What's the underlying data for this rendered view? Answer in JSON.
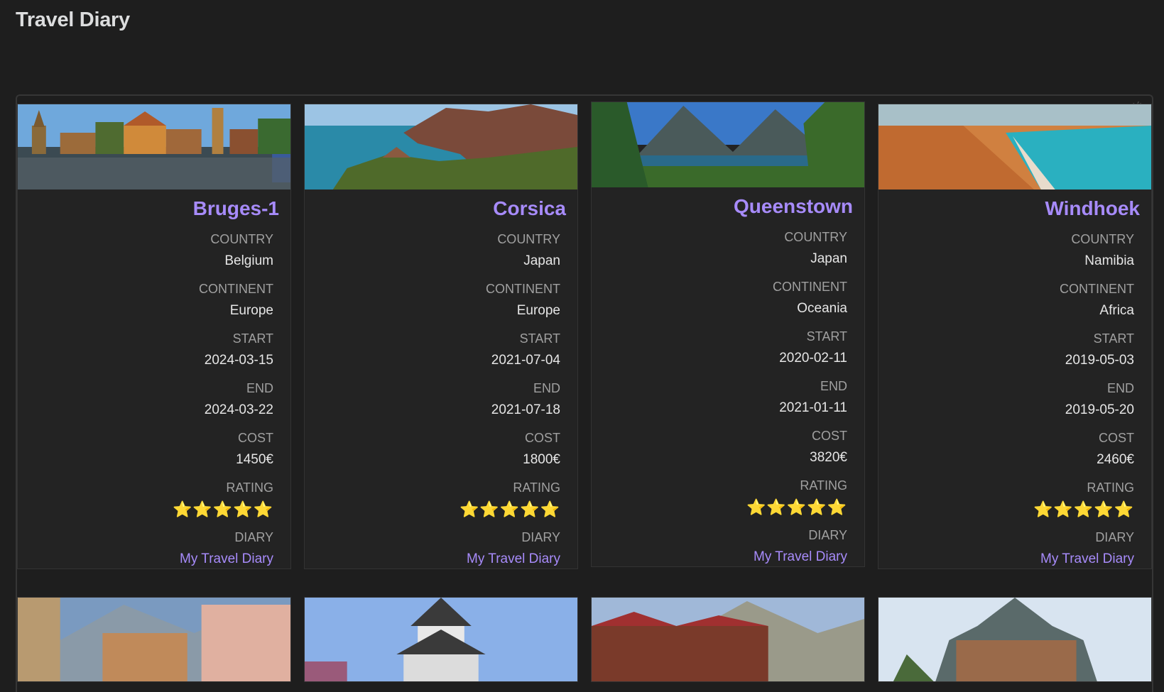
{
  "page": {
    "title": "Travel Diary"
  },
  "gallery": {
    "code_icon": "</>"
  },
  "labels": {
    "country": "COUNTRY",
    "continent": "CONTINENT",
    "start": "START",
    "end": "END",
    "cost": "COST",
    "rating": "RATING",
    "diary": "DIARY"
  },
  "cards": [
    {
      "title": "Bruges-1",
      "country": "Belgium",
      "continent": "Europe",
      "start": "2024-03-15",
      "end": "2024-03-22",
      "cost": "1450€",
      "rating": "⭐⭐⭐⭐⭐",
      "diary": "My Travel Diary"
    },
    {
      "title": "Corsica",
      "country": "Japan",
      "continent": "Europe",
      "start": "2021-07-04",
      "end": "2021-07-18",
      "cost": "1800€",
      "rating": "⭐⭐⭐⭐⭐",
      "diary": "My Travel Diary"
    },
    {
      "title": "Queenstown",
      "country": "Japan",
      "continent": "Oceania",
      "start": "2020-02-11",
      "end": "2021-01-11",
      "cost": "3820€",
      "rating": "⭐⭐⭐⭐⭐",
      "diary": "My Travel Diary"
    },
    {
      "title": "Windhoek",
      "country": "Namibia",
      "continent": "Africa",
      "start": "2019-05-03",
      "end": "2019-05-20",
      "cost": "2460€",
      "rating": "⭐⭐⭐⭐⭐",
      "diary": "My Travel Diary"
    }
  ],
  "colors": {
    "accent": "#a78bfa",
    "star": "#f5c518",
    "background": "#1e1e1e",
    "card": "#232323"
  }
}
